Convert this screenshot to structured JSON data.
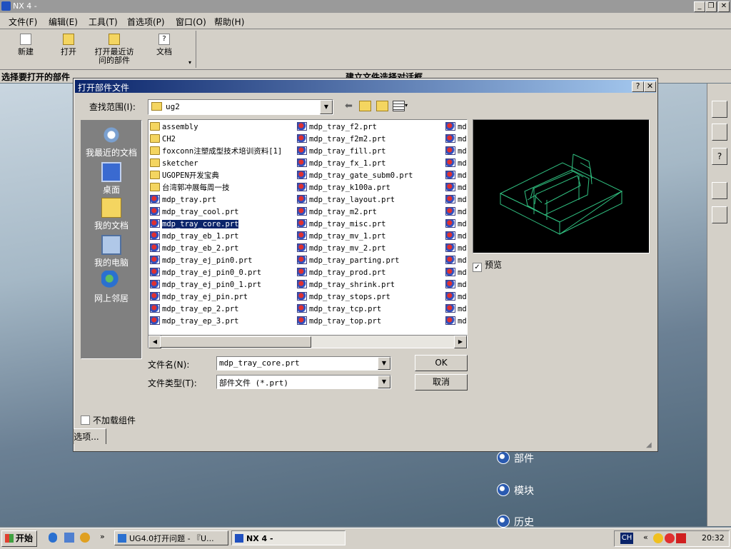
{
  "app": {
    "title": "NX 4 -"
  },
  "menu": [
    "文件(F)",
    "编辑(E)",
    "工具(T)",
    "首选项(P)",
    "窗口(O)",
    "帮助(H)"
  ],
  "toolbar": {
    "new": "新建",
    "open": "打开",
    "open_recent": "打开最近访问的部件",
    "docs": "文档"
  },
  "status": {
    "left": "选择要打开的部件",
    "right": "建立文件选择对话框"
  },
  "dialog": {
    "title": "打开部件文件",
    "look_in_label": "查找范围(I):",
    "look_in_value": "ug2",
    "places": [
      "我最近的文档",
      "桌面",
      "我的文档",
      "我的电脑",
      "网上邻居"
    ],
    "columns": [
      [
        {
          "n": "assembly",
          "t": "folder"
        },
        {
          "n": "CH2",
          "t": "folder"
        },
        {
          "n": "foxconn注塑成型技术培训资料[1]",
          "t": "folder"
        },
        {
          "n": "sketcher",
          "t": "folder"
        },
        {
          "n": "UGOPEN开发宝典",
          "t": "folder"
        },
        {
          "n": "台湾郭冲展每周一技",
          "t": "folder"
        },
        {
          "n": "mdp_tray.prt",
          "t": "prt"
        },
        {
          "n": "mdp_tray_cool.prt",
          "t": "prt"
        },
        {
          "n": "mdp_tray_core.prt",
          "t": "prt",
          "sel": true
        },
        {
          "n": "mdp_tray_eb_1.prt",
          "t": "prt"
        },
        {
          "n": "mdp_tray_eb_2.prt",
          "t": "prt"
        },
        {
          "n": "mdp_tray_ej_pin0.prt",
          "t": "prt"
        },
        {
          "n": "mdp_tray_ej_pin0_0.prt",
          "t": "prt"
        },
        {
          "n": "mdp_tray_ej_pin0_1.prt",
          "t": "prt"
        },
        {
          "n": "mdp_tray_ej_pin.prt",
          "t": "prt"
        },
        {
          "n": "mdp_tray_ep_2.prt",
          "t": "prt"
        },
        {
          "n": "mdp_tray_ep_3.prt",
          "t": "prt"
        }
      ],
      [
        {
          "n": "mdp_tray_f2.prt",
          "t": "prt"
        },
        {
          "n": "mdp_tray_f2m2.prt",
          "t": "prt"
        },
        {
          "n": "mdp_tray_fill.prt",
          "t": "prt"
        },
        {
          "n": "mdp_tray_fx_1.prt",
          "t": "prt"
        },
        {
          "n": "mdp_tray_gate_subm0.prt",
          "t": "prt"
        },
        {
          "n": "mdp_tray_k100a.prt",
          "t": "prt"
        },
        {
          "n": "mdp_tray_layout.prt",
          "t": "prt"
        },
        {
          "n": "mdp_tray_m2.prt",
          "t": "prt"
        },
        {
          "n": "mdp_tray_misc.prt",
          "t": "prt"
        },
        {
          "n": "mdp_tray_mv_1.prt",
          "t": "prt"
        },
        {
          "n": "mdp_tray_mv_2.prt",
          "t": "prt"
        },
        {
          "n": "mdp_tray_parting.prt",
          "t": "prt"
        },
        {
          "n": "mdp_tray_prod.prt",
          "t": "prt"
        },
        {
          "n": "mdp_tray_shrink.prt",
          "t": "prt"
        },
        {
          "n": "mdp_tray_stops.prt",
          "t": "prt"
        },
        {
          "n": "mdp_tray_tcp.prt",
          "t": "prt"
        },
        {
          "n": "mdp_tray_top.prt",
          "t": "prt"
        }
      ],
      [
        {
          "n": "md",
          "t": "prt"
        },
        {
          "n": "md",
          "t": "prt"
        },
        {
          "n": "md",
          "t": "prt"
        },
        {
          "n": "md",
          "t": "prt"
        },
        {
          "n": "md",
          "t": "prt"
        },
        {
          "n": "md",
          "t": "prt"
        },
        {
          "n": "md",
          "t": "prt"
        },
        {
          "n": "md",
          "t": "prt"
        },
        {
          "n": "md",
          "t": "prt"
        },
        {
          "n": "md",
          "t": "prt"
        },
        {
          "n": "md",
          "t": "prt"
        },
        {
          "n": "md",
          "t": "prt"
        },
        {
          "n": "md",
          "t": "prt"
        },
        {
          "n": "md",
          "t": "prt"
        },
        {
          "n": "md",
          "t": "prt"
        },
        {
          "n": "md",
          "t": "prt"
        },
        {
          "n": "md",
          "t": "prt"
        }
      ]
    ],
    "preview_label": "预览",
    "filename_label": "文件名(N):",
    "filename_value": "mdp_tray_core.prt",
    "filetype_label": "文件类型(T):",
    "filetype_value": "部件文件 (*.prt)",
    "ok": "OK",
    "cancel": "取消",
    "no_load": "不加载组件",
    "options": "选项..."
  },
  "right_links": [
    "部件",
    "模块",
    "历史"
  ],
  "taskbar": {
    "start": "开始",
    "tasks": [
      "UG4.0打开问题 - 『U...",
      "NX 4 -"
    ],
    "lang": "CH",
    "time": "20:32"
  }
}
